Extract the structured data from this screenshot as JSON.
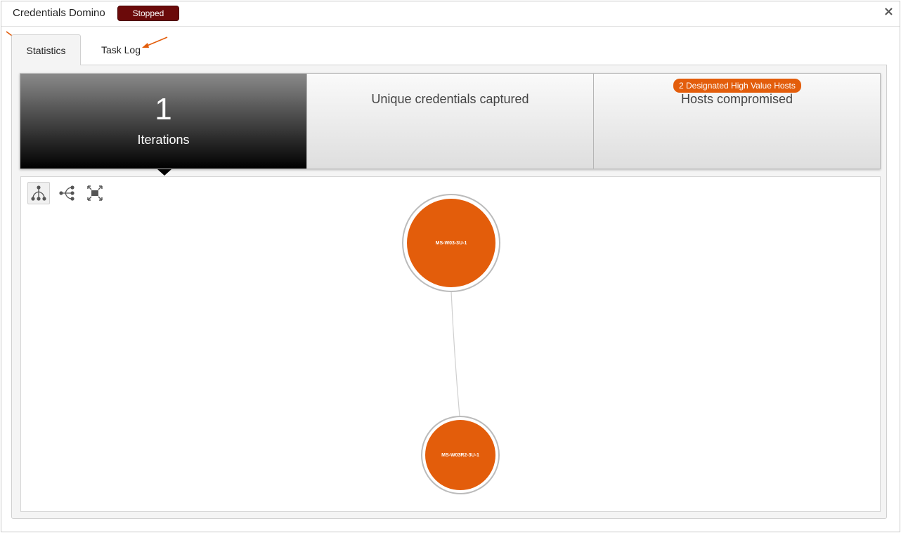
{
  "window": {
    "title": "Credentials Domino",
    "status": "Stopped",
    "close_symbol": "×",
    "close_icon": "close-icon"
  },
  "tabs": [
    {
      "label": "Statistics",
      "active": true
    },
    {
      "label": "Task Log",
      "active": false
    }
  ],
  "stats": {
    "iterations": {
      "value": "1",
      "label": "Iterations"
    },
    "credentials": {
      "label": "Unique credentials captured"
    },
    "hosts": {
      "label": "Hosts compromised",
      "badge": "2 Designated High Value Hosts"
    }
  },
  "graph": {
    "tools": [
      {
        "icon": "tree-layout-icon",
        "selected": true
      },
      {
        "icon": "horizontal-tree-icon",
        "selected": false
      },
      {
        "icon": "fit-to-screen-icon",
        "selected": false
      }
    ],
    "nodes": [
      {
        "label": "MS-W03-3U-1"
      },
      {
        "label": "MS-W03R2-3U-1"
      }
    ]
  },
  "colors": {
    "accent": "#e35d0b",
    "status_badge": "#6b0a0a",
    "annotation_arrow": "#e35d0b"
  }
}
